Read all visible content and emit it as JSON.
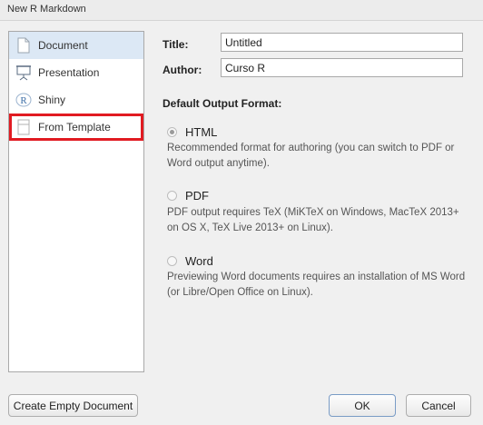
{
  "window": {
    "title": "New R Markdown"
  },
  "sidebar": {
    "items": [
      {
        "label": "Document",
        "icon": "document-icon"
      },
      {
        "label": "Presentation",
        "icon": "presentation-icon"
      },
      {
        "label": "Shiny",
        "icon": "shiny-r-icon"
      },
      {
        "label": "From Template",
        "icon": "template-icon"
      }
    ]
  },
  "form": {
    "title_label": "Title:",
    "title_value": "Untitled",
    "author_label": "Author:",
    "author_value": "Curso R"
  },
  "output": {
    "heading": "Default Output Format:",
    "options": [
      {
        "label": "HTML",
        "desc": "Recommended format for authoring (you can switch to PDF or Word output anytime).",
        "checked": true
      },
      {
        "label": "PDF",
        "desc": "PDF output requires TeX (MiKTeX on Windows, MacTeX 2013+ on OS X, TeX Live 2013+ on Linux).",
        "checked": false
      },
      {
        "label": "Word",
        "desc": "Previewing Word documents requires an installation of MS Word (or Libre/Open Office on Linux).",
        "checked": false
      }
    ]
  },
  "buttons": {
    "create_empty": "Create Empty Document",
    "ok": "OK",
    "cancel": "Cancel"
  },
  "colors": {
    "highlight": "#e11b22",
    "selected_bg": "#dce8f5"
  }
}
